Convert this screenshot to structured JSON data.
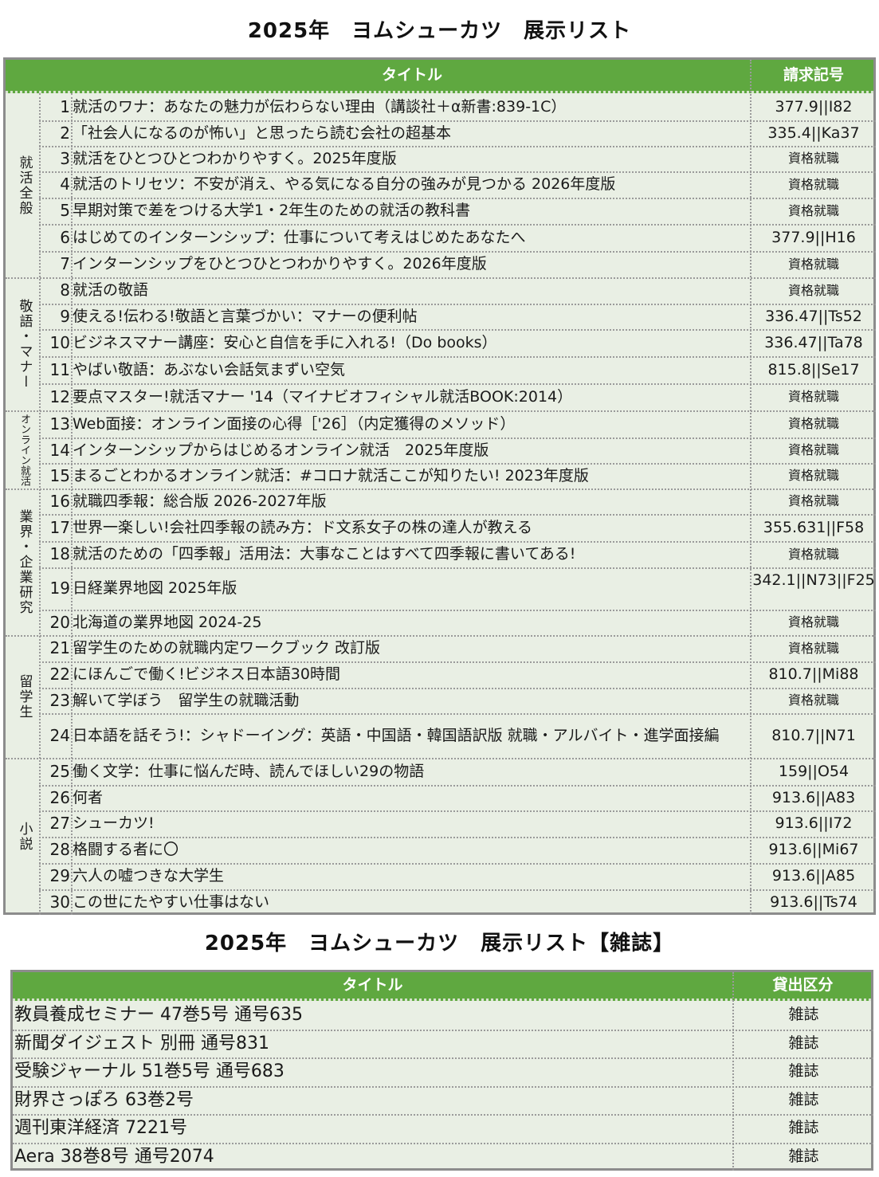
{
  "title": "2025年　ヨムシューカツ　展示リスト",
  "magazine_title": "2025年　ヨムシューカツ　展示リスト【雑誌】",
  "colors": {
    "header_green": "#5fa840",
    "row_bg": "#e9efe4",
    "border": "#8c8c8c"
  },
  "table": {
    "headers": {
      "title": "タイトル",
      "call_number": "請求記号"
    },
    "categories": [
      {
        "label": "就活全般"
      },
      {
        "label": "敬語・マナー"
      },
      {
        "label": "オンライン就活"
      },
      {
        "label": "業界・企業研究"
      },
      {
        "label": "留学生"
      },
      {
        "label": "小説"
      }
    ],
    "rows": [
      {
        "no": "1",
        "title": "就活のワナ：あなたの魅力が伝わらない理由（講談社＋α新書:839-1C）",
        "call": "377.9||I82"
      },
      {
        "no": "2",
        "title": "「社会人になるのが怖い」と思ったら読む会社の超基本",
        "call": "335.4||Ka37"
      },
      {
        "no": "3",
        "title": "就活をひとつひとつわかりやすく。2025年度版",
        "call": "資格就職"
      },
      {
        "no": "4",
        "title": "就活のトリセツ：不安が消え、やる気になる自分の強みが見つかる 2026年度版",
        "call": "資格就職"
      },
      {
        "no": "5",
        "title": "早期対策で差をつける大学1・2年生のための就活の教科書",
        "call": "資格就職"
      },
      {
        "no": "6",
        "title": "はじめてのインターンシップ：仕事について考えはじめたあなたへ",
        "call": "377.9||H16"
      },
      {
        "no": "7",
        "title": "インターンシップをひとつひとつわかりやすく。2026年度版",
        "call": "資格就職"
      },
      {
        "no": "8",
        "title": "就活の敬語",
        "call": "資格就職"
      },
      {
        "no": "9",
        "title": "使える!伝わる!敬語と言葉づかい：マナーの便利帖",
        "call": "336.47||Ts52"
      },
      {
        "no": "10",
        "title": "ビジネスマナー講座：安心と自信を手に入れる!（Do books）",
        "call": "336.47||Ta78"
      },
      {
        "no": "11",
        "title": "やばい敬語：あぶない会話気まずい空気",
        "call": "815.8||Se17"
      },
      {
        "no": "12",
        "title": "要点マスター!就活マナー '14（マイナビオフィシャル就活BOOK:2014）",
        "call": "資格就職"
      },
      {
        "no": "13",
        "title": "Web面接：オンライン面接の心得［'26］（内定獲得のメソッド）",
        "call": "資格就職"
      },
      {
        "no": "14",
        "title": "インターンシップからはじめるオンライン就活　2025年度版",
        "call": "資格就職"
      },
      {
        "no": "15",
        "title": "まるごとわかるオンライン就活：#コロナ就活ここが知りたい! 2023年度版",
        "call": "資格就職"
      },
      {
        "no": "16",
        "title": "就職四季報：総合版 2026-2027年版",
        "call": "資格就職"
      },
      {
        "no": "17",
        "title": "世界一楽しい!会社四季報の読み方：ド文系女子の株の達人が教える",
        "call": "355.631||F58"
      },
      {
        "no": "18",
        "title": "就活のための「四季報」活用法：大事なことはすべて四季報に書いてある!",
        "call": "資格就職"
      },
      {
        "no": "19",
        "title": "日経業界地図 2025年版",
        "call": "342.1||N73||F25"
      },
      {
        "no": "20",
        "title": "北海道の業界地図 2024-25",
        "call": "資格就職"
      },
      {
        "no": "21",
        "title": "留学生のための就職内定ワークブック 改訂版",
        "call": "資格就職"
      },
      {
        "no": "22",
        "title": "にほんごで働く!ビジネス日本語30時間",
        "call": "810.7||Mi88"
      },
      {
        "no": "23",
        "title": "解いて学ぼう　留学生の就職活動",
        "call": "資格就職"
      },
      {
        "no": "24",
        "title": "日本語を話そう!：シャドーイング：英語・中国語・韓国語訳版 就職・アルバイト・進学面接編",
        "call": "810.7||N71"
      },
      {
        "no": "25",
        "title": "働く文学：仕事に悩んだ時、読んでほしい29の物語",
        "call": "159||O54"
      },
      {
        "no": "26",
        "title": "何者",
        "call": "913.6||A83"
      },
      {
        "no": "27",
        "title": "シューカツ!",
        "call": "913.6||I72"
      },
      {
        "no": "28",
        "title": "格闘する者に〇",
        "call": "913.6||Mi67"
      },
      {
        "no": "29",
        "title": "六人の嘘つきな大学生",
        "call": "913.6||A85"
      },
      {
        "no": "30",
        "title": "この世にたやすい仕事はない",
        "call": "913.6||Ts74"
      }
    ]
  },
  "magazines": {
    "headers": {
      "title": "タイトル",
      "kind": "貸出区分"
    },
    "rows": [
      {
        "title": "教員養成セミナー 47巻5号 通号635",
        "kind": "雑誌"
      },
      {
        "title": "新聞ダイジェスト 別冊 通号831",
        "kind": "雑誌"
      },
      {
        "title": "受験ジャーナル 51巻5号 通号683",
        "kind": "雑誌"
      },
      {
        "title": "財界さっぽろ 63巻2号",
        "kind": "雑誌"
      },
      {
        "title": "週刊東洋経済 7221号",
        "kind": "雑誌"
      },
      {
        "title": "Aera 38巻8号 通号2074",
        "kind": "雑誌"
      }
    ]
  }
}
